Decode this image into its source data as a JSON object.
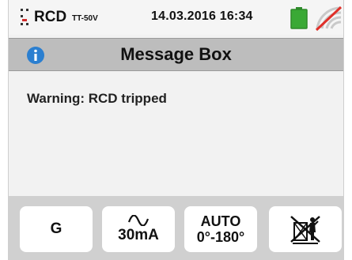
{
  "status": {
    "function": "RCD",
    "subtitle": "TT-50V",
    "datetime": "14.03.2016  16:34",
    "battery_color": "#3aa935",
    "wireless_slash_color": "#e0302a"
  },
  "title_bar": {
    "title": "Message Box",
    "info_icon_color": "#2b7fd0"
  },
  "message": {
    "text": "Warning: RCD tripped"
  },
  "softkeys": [
    {
      "label": "G"
    },
    {
      "icon": "sine-wave-icon",
      "label": "30mA"
    },
    {
      "line1": "AUTO",
      "line2": "0°-180°"
    },
    {
      "icon": "no-earth-icon"
    }
  ]
}
